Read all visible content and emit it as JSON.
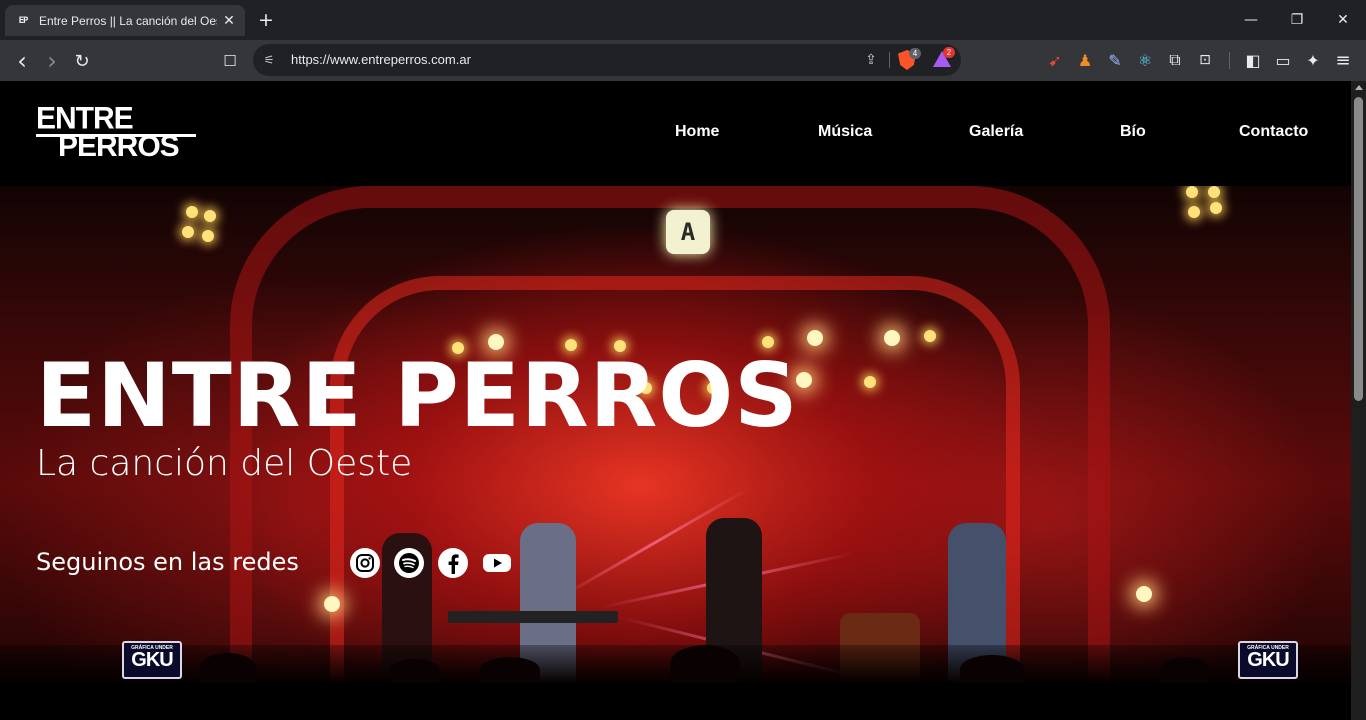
{
  "browser": {
    "tab": {
      "title": "Entre Perros || La canción del Oeste",
      "favicon": "entre-perros-favicon"
    },
    "url": "https://www.entreperros.com.ar",
    "shield_count": "4",
    "rewards_count": "2",
    "icons": {
      "back": "‹",
      "forward": "›",
      "reload": "↻",
      "bookmark": "☐",
      "tune": "⚟",
      "share": "⇪",
      "new_tab": "+",
      "minimize": "—",
      "maximize": "❐",
      "close": "✕",
      "tab_close": "✕",
      "menu": "≡"
    }
  },
  "site": {
    "logo": {
      "line1": "ENTRE",
      "line2": "PERROS"
    },
    "nav": [
      {
        "label": "Home"
      },
      {
        "label": "Música"
      },
      {
        "label": "Galería"
      },
      {
        "label": "Bío"
      },
      {
        "label": "Contacto"
      }
    ],
    "hero": {
      "title": "ENTRE PERROS",
      "subtitle": "La canción del Oeste",
      "social_label": "Seguinos en las redes",
      "social": [
        {
          "name": "instagram-icon"
        },
        {
          "name": "spotify-icon"
        },
        {
          "name": "facebook-icon"
        },
        {
          "name": "youtube-icon"
        }
      ],
      "watermark": {
        "small": "GRÁFICA UNDER",
        "big": "GKU"
      },
      "emblem": "A"
    }
  },
  "colors": {
    "chrome_bg": "#202124",
    "toolbar_bg": "#35363a",
    "page_bg": "#000000",
    "accent_red": "#e0201e",
    "text": "#ffffff"
  }
}
